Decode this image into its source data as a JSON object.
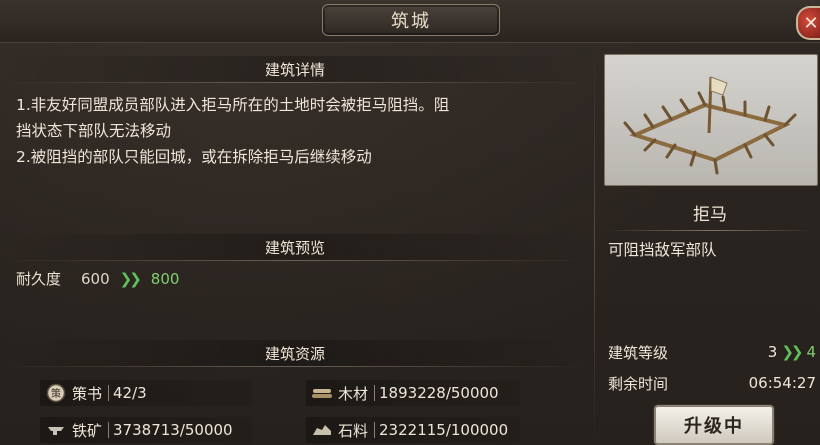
{
  "header": {
    "title": "筑城"
  },
  "detail_section": {
    "header": "建筑详情",
    "lines": [
      "1.非友好同盟成员部队进入拒马所在的土地时会被拒马阻挡。阻",
      "挡状态下部队无法移动",
      "2.被阻挡的部队只能回城，或在拆除拒马后继续移动"
    ]
  },
  "preview_section": {
    "header": "建筑预览",
    "durability_label": "耐久度",
    "durability_old": "600",
    "durability_new": "800"
  },
  "resource_section": {
    "header": "建筑资源",
    "items": [
      {
        "icon": "strategy-book-icon",
        "label": "策书",
        "value": "42/3"
      },
      {
        "icon": "wood-icon",
        "label": "木材",
        "value": "1893228/50000"
      },
      {
        "icon": "iron-icon",
        "label": "铁矿",
        "value": "3738713/50000"
      },
      {
        "icon": "stone-icon",
        "label": "石料",
        "value": "2322115/100000"
      }
    ]
  },
  "building": {
    "name": "拒马",
    "description": "可阻挡敌军部队",
    "level_label": "建筑等级",
    "level_old": "3",
    "level_new": "4",
    "remaining_label": "剩余时间",
    "remaining_time": "06:54:27",
    "upgrade_button": "升级中"
  },
  "colors": {
    "accent_green": "#7ed06f",
    "close_red": "#c23a2e"
  }
}
